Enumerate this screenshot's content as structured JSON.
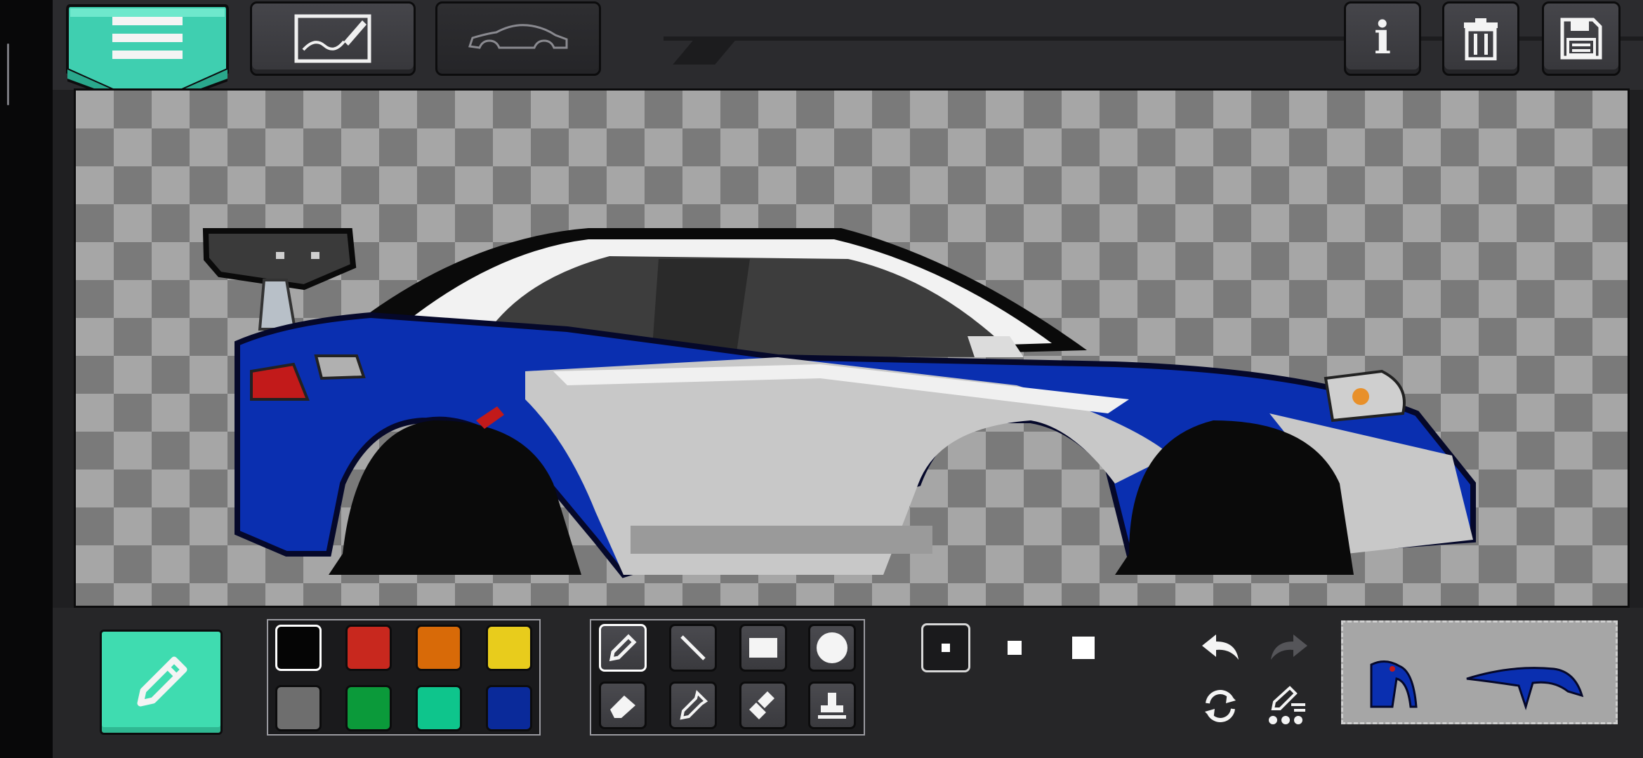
{
  "app": {
    "screen": "car-paint-editor"
  },
  "top_toolbar": {
    "left_buttons": [
      {
        "name": "menu",
        "icon": "hamburger-menu-icon"
      },
      {
        "name": "draw-mode",
        "icon": "drawing-canvas-icon"
      },
      {
        "name": "car-shape-mode",
        "icon": "car-outline-icon"
      }
    ],
    "right_buttons": [
      {
        "name": "info",
        "icon": "info-icon",
        "label": "i"
      },
      {
        "name": "delete",
        "icon": "trash-icon"
      },
      {
        "name": "save",
        "icon": "floppy-disk-icon"
      }
    ]
  },
  "palette": {
    "selected_index": 0,
    "colors": [
      "#050505",
      "#c8281e",
      "#d86a08",
      "#e8cc1c",
      "#6e6e6e",
      "#0b9a3a",
      "#0ec58c",
      "#0a2a9a"
    ]
  },
  "tools": {
    "selected": "pencil",
    "items": [
      {
        "name": "pencil",
        "icon": "pencil-icon"
      },
      {
        "name": "line",
        "icon": "line-icon"
      },
      {
        "name": "rectangle",
        "icon": "rectangle-icon"
      },
      {
        "name": "circle",
        "icon": "circle-icon"
      },
      {
        "name": "eraser",
        "icon": "eraser-icon"
      },
      {
        "name": "eyedropper",
        "icon": "eyedropper-icon"
      },
      {
        "name": "spray",
        "icon": "spray-can-icon"
      },
      {
        "name": "stamp",
        "icon": "stamp-icon"
      }
    ]
  },
  "brush_sizes": {
    "selected_index": 0,
    "options": [
      "small",
      "medium",
      "large"
    ]
  },
  "history": {
    "undo_icon": "undo-arrow-icon",
    "redo_icon": "redo-arrow-icon",
    "redo_enabled": false,
    "rotate_icon": "rotate-icon",
    "layers_icon": "pen-settings-icon"
  },
  "colors": {
    "accent": "#3fdcb0",
    "car_blue": "#0a2fb0",
    "car_silver": "#c8c8c8",
    "checker_light": "#a6a6a6",
    "checker_dark": "#7a7a7a"
  }
}
